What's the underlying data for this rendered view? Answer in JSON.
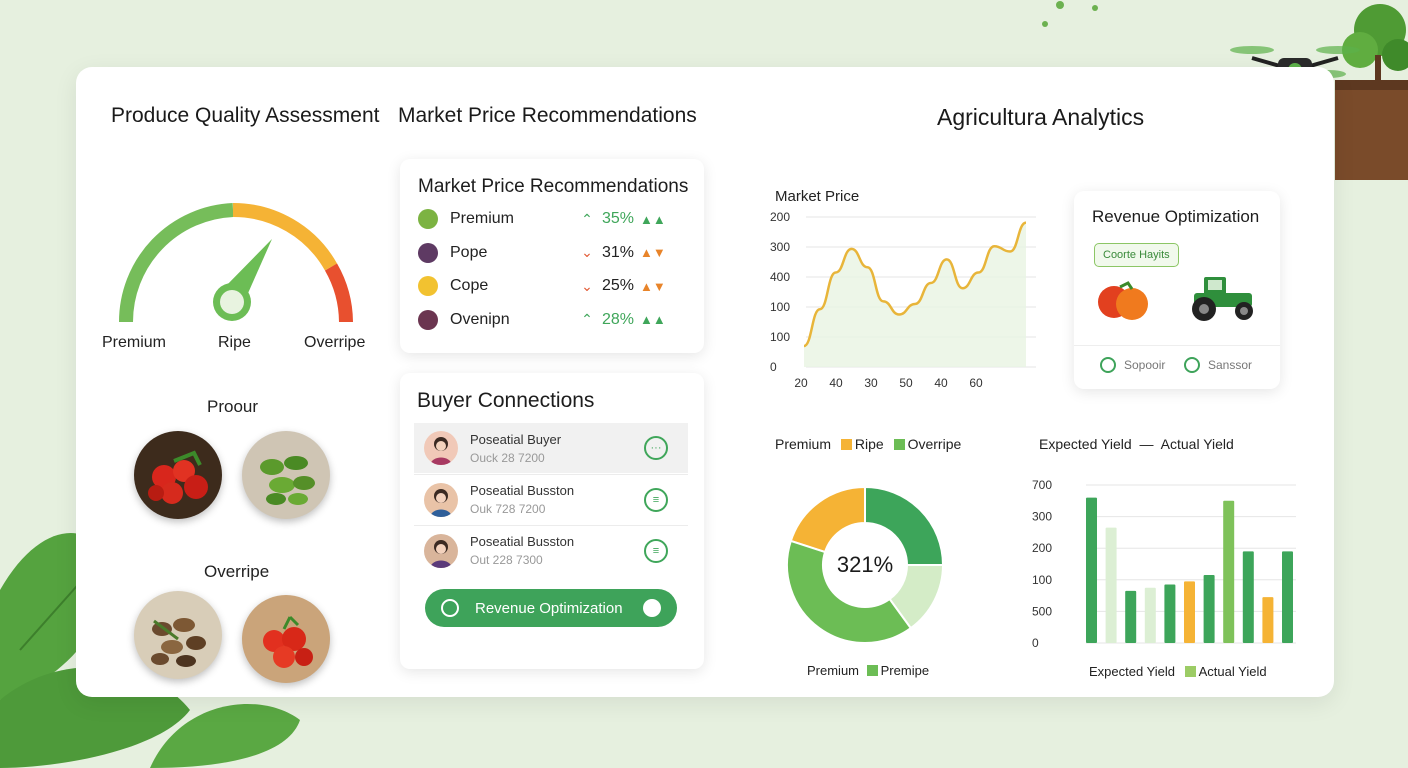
{
  "section_titles": {
    "quality": "Produce Quality Assessment",
    "market": "Market Price Recommendations",
    "app": "Agricultura Analytics"
  },
  "gauge": {
    "labels": [
      "Premium",
      "Ripe",
      "Overripe"
    ]
  },
  "produce": {
    "group1_label": "Proour",
    "group2_label": "Overripe"
  },
  "market_card": {
    "title": "Market Price Recommendations",
    "rows": [
      {
        "name": "Premium",
        "pct": "35%",
        "trend": "up",
        "color": "#7cb342"
      },
      {
        "name": "Pope",
        "pct": "31%",
        "trend": "down",
        "color": "#5e3a63"
      },
      {
        "name": "Cope",
        "pct": "25%",
        "trend": "down",
        "color": "#f2c230"
      },
      {
        "name": "Ovenipn",
        "pct": "28%",
        "trend": "up",
        "color": "#6b3550"
      }
    ]
  },
  "buyers_card": {
    "title": "Buyer Connections",
    "rows": [
      {
        "name": "Poseatial Buyer",
        "phone": "Ouck 28 7200"
      },
      {
        "name": "Poseatial Busston",
        "phone": "Ouk 728 7200"
      },
      {
        "name": "Poseatial Busston",
        "phone": "Out 228 7300"
      }
    ],
    "cta_label": "Revenue Optimization"
  },
  "revenue_card": {
    "title": "Revenue Optimization",
    "chip": "Coorte Hayits",
    "footer_left": "Sopooir",
    "footer_right": "Sanssor"
  },
  "line_chart": {
    "title": "Market Price"
  },
  "donut": {
    "center_label": "321%"
  },
  "bar_chart": {
    "title_left": "Expected Yield",
    "title_sep": "—",
    "title_right": "Actual Yield"
  },
  "colors": {
    "green": "#3fa65a",
    "light_green": "#8cc665",
    "orange": "#f5b335",
    "red": "#e25a35"
  },
  "chart_data": [
    {
      "type": "line",
      "title": "Market Price",
      "x_ticks": [
        "20",
        "40",
        "30",
        "50",
        "40",
        "60"
      ],
      "y_ticks": [
        "200",
        "300",
        "400",
        "100",
        "100",
        "0"
      ],
      "series": [
        {
          "values": [
            0.8,
            2.2,
            3.6,
            4.5,
            3.8,
            2.5,
            2.0,
            2.4,
            3.2,
            4.1,
            3.0,
            3.6,
            4.6,
            4.4,
            5.5
          ]
        }
      ]
    },
    {
      "type": "pie",
      "legend_top": [
        "Premium",
        "Ripe",
        "Overripe"
      ],
      "legend_bottom": [
        "Premium",
        "Premipe"
      ],
      "slices": [
        {
          "value": 25,
          "color": "#3da55a"
        },
        {
          "value": 15,
          "color": "#d4ecc7"
        },
        {
          "value": 40,
          "color": "#6cbd55"
        },
        {
          "value": 20,
          "color": "#f5b335"
        }
      ]
    },
    {
      "type": "bar",
      "y_ticks": [
        "700",
        "300",
        "200",
        "100",
        "500",
        "0"
      ],
      "legend": [
        "Expected Yield",
        "Actual Yield"
      ],
      "bars": [
        {
          "value": 0.92,
          "color": "#3da55a"
        },
        {
          "value": 0.73,
          "color": "#dcefd4"
        },
        {
          "value": 0.33,
          "color": "#3da55a"
        },
        {
          "value": 0.35,
          "color": "#dcefd4"
        },
        {
          "value": 0.37,
          "color": "#3da55a"
        },
        {
          "value": 0.39,
          "color": "#f5b335"
        },
        {
          "value": 0.43,
          "color": "#3da55a"
        },
        {
          "value": 0.9,
          "color": "#7fc25a"
        },
        {
          "value": 0.58,
          "color": "#3da55a"
        },
        {
          "value": 0.29,
          "color": "#f5b335"
        },
        {
          "value": 0.58,
          "color": "#3da55a"
        }
      ]
    }
  ]
}
